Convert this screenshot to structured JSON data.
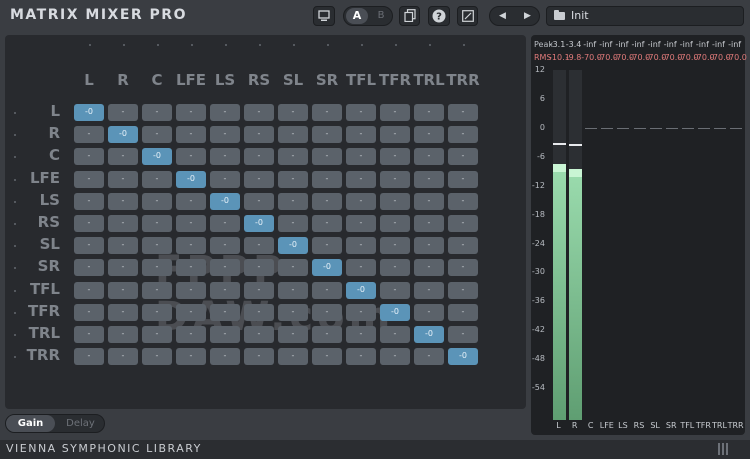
{
  "app": {
    "title": "MATRIX MIXER PRO",
    "footer": "VIENNA SYMPHONIC LIBRARY"
  },
  "toolbar": {
    "ab": {
      "a": "A",
      "b": "B"
    },
    "preset_name": "Init"
  },
  "watermark": "FPPP-DAW.com",
  "channels": [
    "L",
    "R",
    "C",
    "LFE",
    "LS",
    "RS",
    "SL",
    "SR",
    "TFL",
    "TFR",
    "TRL",
    "TRR"
  ],
  "matrix": {
    "default_value": "-",
    "active_value": "-0",
    "active_diagonal": true
  },
  "meters": {
    "peak_label": "Peak",
    "rms_label": "RMS",
    "peak_values": [
      "-3.1",
      "-3.4",
      "-inf",
      "-inf",
      "-inf",
      "-inf",
      "-inf",
      "-inf",
      "-inf",
      "-inf",
      "-inf",
      "-inf"
    ],
    "rms_values": [
      "-10.1",
      "-9.8",
      "-70.0",
      "-70.0",
      "-70.0",
      "-70.0",
      "-70.0",
      "-70.0",
      "-70.0",
      "-70.0",
      "-70.0",
      "-70.0"
    ],
    "scale": [
      "12",
      "6",
      "0",
      "-6",
      "-12",
      "-18",
      "-24",
      "-30",
      "-36",
      "-42",
      "-48",
      "-54"
    ],
    "levels_db": [
      -7.5,
      -8.6,
      null,
      null,
      null,
      null,
      null,
      null,
      null,
      null,
      null,
      null
    ],
    "peak_colors": {
      "peak": "#c9ccd1",
      "rms": "#e07a7a"
    }
  },
  "tabs": [
    {
      "label": "Gain",
      "active": true
    },
    {
      "label": "Delay",
      "active": false
    }
  ]
}
